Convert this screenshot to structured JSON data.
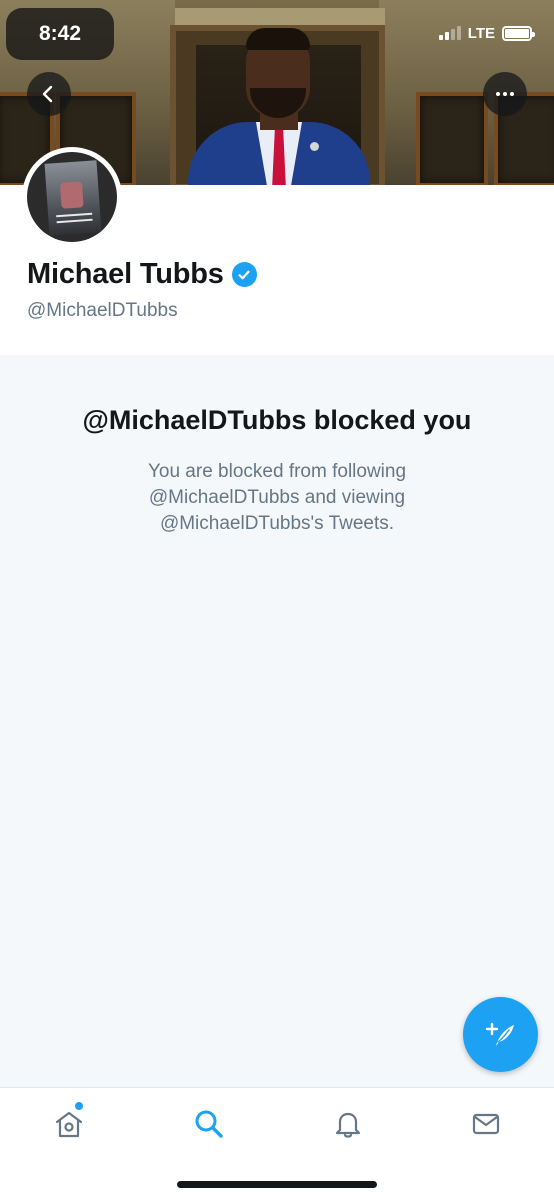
{
  "status_bar": {
    "time": "8:42",
    "network": "LTE"
  },
  "profile": {
    "name": "Michael Tubbs",
    "handle": "@MichaelDTubbs",
    "verified": true
  },
  "blocked": {
    "title": "@MichaelDTubbs blocked you",
    "body": "You are blocked from following @MichaelDTubbs and viewing @MichaelDTubbs's Tweets."
  },
  "icons": {
    "back": "back-arrow-icon",
    "more": "more-dots-icon",
    "verified": "verified-badge-icon",
    "compose": "compose-tweet-icon",
    "tabs": [
      "home-icon",
      "search-icon",
      "notifications-bell-icon",
      "messages-envelope-icon"
    ]
  },
  "tabbar": {
    "active_tab": "search",
    "home_has_new": true
  },
  "colors": {
    "accent": "#1da1f2",
    "text_primary": "#14171a",
    "text_secondary": "#657786",
    "background": "#f5f8fa"
  }
}
